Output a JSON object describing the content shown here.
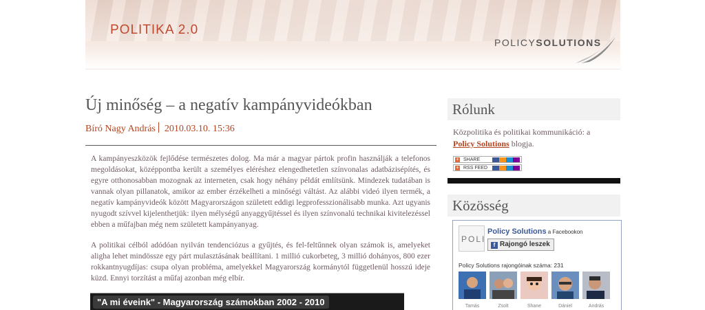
{
  "header": {
    "site_title": "POLITIKA 2.0",
    "brand_regular": "POLICY",
    "brand_bold": "SOLUTIONS"
  },
  "post": {
    "title": "Új minőség – a negatív kampányvideókban",
    "author": "Bíró Nagy András",
    "date": "2010.03.10. 15:36",
    "paragraphs": [
      "A kampányeszközök fejlődése természetes dolog. Ma már a magyar pártok profin használják a telefonos megoldásokat, középpontba került a személyes eléréshez elengedhetetlen színvonalas adatbázisépítés, és egyre otthonosabban mozognak az interneten, csak hogy néhány példát említsünk. Mindezek tudatában is vannak olyan pillanatok, amikor az ember érzékelheti a minőségi váltást. Az alábbi videó ilyen termék, a negatív kampányvideók között Magyarországon született eddigi legprofesszionálisabb munka. Azt ugyanis nyugodt szívvel kijelenthetjük: ilyen mélységű anyaggyűjtéssel és ilyen színvonalú technikai kivitelezéssel ebben a műfajban még nem született kampányanyag.",
      "A politikai célból adódóan nyilván tendenciózus a gyűjtés, és fel-feltűnnek olyan számok is, amelyeket aligha lehet mindössze egy párt mulasztásának beállítani. 1 millió cukorbeteg, 3 millió dohányos, 800 ezer rokkantnyugdíjas: csupa olyan probléma, amelyekkel Magyarország kormánytól függetlenül hosszú ideje küzd. Ennyi torzítást a műfaj azonban még elbír."
    ],
    "video_title": "\"A mi éveink\" - Magyarország számokban 2002 - 2010"
  },
  "sidebar": {
    "about": {
      "heading": "Rólunk",
      "text_before": "Közpolitika és politikai kommunikáció: a",
      "link": "Policy Solutions",
      "text_after": " blogja.",
      "share_label": "SHARE",
      "rss_label": "RSS FEED"
    },
    "community": {
      "heading": "Közösség",
      "fb": {
        "logo_text": "POLI",
        "page_name": "Policy Solutions",
        "page_suffix": " a Facebookon",
        "like_label": "Rajongó leszek",
        "fans_count": "Policy Solutions rajongóinak száma: 231",
        "fans": [
          {
            "name": "Tamás"
          },
          {
            "name": "Zsolt"
          },
          {
            "name": "Shane"
          },
          {
            "name": "Dániel"
          },
          {
            "name": "András"
          }
        ]
      }
    }
  },
  "colors": {
    "accent": "#b5441f",
    "title": "#c0492f",
    "facebook": "#3b5998"
  }
}
